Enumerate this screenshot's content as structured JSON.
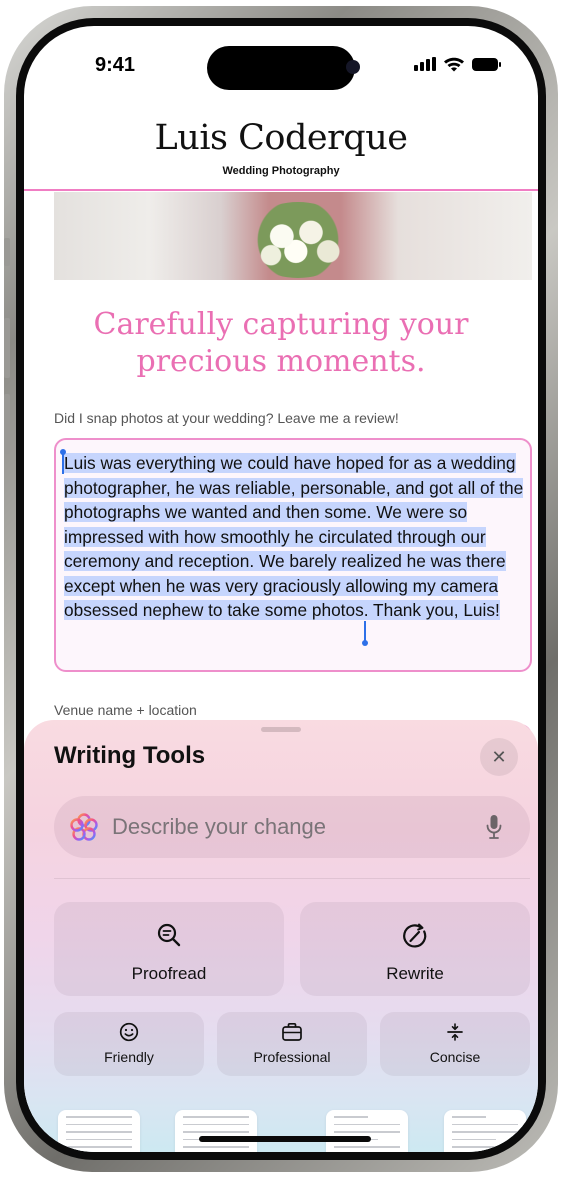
{
  "status_bar": {
    "time": "9:41"
  },
  "site": {
    "title": "Luis Coderque",
    "subtitle": "Wedding Photography",
    "headline_line1": "Carefully capturing your",
    "headline_line2": "precious moments."
  },
  "review_form": {
    "label": "Did I snap photos at your wedding? Leave me a review!",
    "text": "Luis was everything we could have hoped for as a wedding photographer, he was reliable, personable, and got all of the photographs we wanted and then some. We were so impressed with how smoothly he circulated through our ceremony and reception. We barely realized he was there except when he was very graciously allowing my camera obsessed nephew to take some photos. Thank you, Luis!"
  },
  "venue_form": {
    "label": "Venue name + location"
  },
  "writing_tools": {
    "title": "Writing Tools",
    "close_icon": "xmark-icon",
    "prompt_placeholder": "Describe your change",
    "primary_actions": [
      {
        "label": "Proofread",
        "icon": "magnifier-icon"
      },
      {
        "label": "Rewrite",
        "icon": "rewrite-arrow-icon"
      }
    ],
    "tone_actions": [
      {
        "label": "Friendly",
        "icon": "smiley-icon"
      },
      {
        "label": "Professional",
        "icon": "briefcase-icon"
      },
      {
        "label": "Concise",
        "icon": "concise-icon"
      }
    ],
    "format_thumbnails": [
      "doc-thumbnail",
      "doc-thumbnail",
      "doc-thumbnail",
      "doc-thumbnail"
    ]
  },
  "colors": {
    "accent_pink": "#ea6fb3",
    "selection_blue": "#c6d5fd",
    "caret_blue": "#2e70e8"
  }
}
